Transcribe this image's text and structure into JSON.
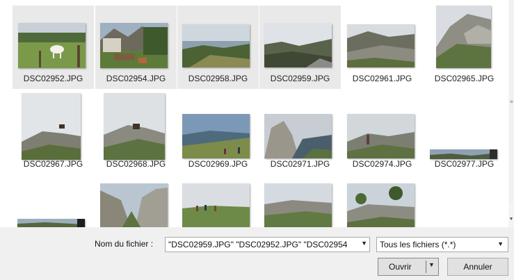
{
  "files": [
    {
      "name": "DSC02952.JPG",
      "selected": true,
      "icon": "photo-cow-pasture-thumbnail"
    },
    {
      "name": "DSC02954.JPG",
      "selected": true,
      "icon": "photo-mountain-hut-thumbnail"
    },
    {
      "name": "DSC02958.JPG",
      "selected": true,
      "icon": "photo-valley-landscape-thumbnail"
    },
    {
      "name": "DSC02959.JPG",
      "selected": true,
      "icon": "photo-cloudy-ridge-thumbnail"
    },
    {
      "name": "DSC02961.JPG",
      "selected": false,
      "icon": "photo-rocky-slope-thumbnail"
    },
    {
      "name": "DSC02965.JPG",
      "selected": false,
      "icon": "photo-cliff-portrait-thumbnail"
    },
    {
      "name": "DSC02967.JPG",
      "selected": false,
      "icon": "photo-ibex-sky-thumbnail"
    },
    {
      "name": "DSC02968.JPG",
      "selected": false,
      "icon": "photo-ibex-rocks-thumbnail"
    },
    {
      "name": "DSC02969.JPG",
      "selected": false,
      "icon": "photo-hikers-valley-thumbnail"
    },
    {
      "name": "DSC02971.JPG",
      "selected": false,
      "icon": "photo-rock-pinnacle-thumbnail"
    },
    {
      "name": "DSC02974.JPG",
      "selected": false,
      "icon": "photo-hiker-ridge-thumbnail"
    },
    {
      "name": "DSC02977.JPG",
      "selected": false,
      "icon": "photo-panorama-thumbnail"
    },
    {
      "name": "",
      "selected": false,
      "icon": "photo-panorama-partial-thumbnail"
    },
    {
      "name": "",
      "selected": false,
      "icon": "photo-cliff-gully-thumbnail"
    },
    {
      "name": "",
      "selected": false,
      "icon": "photo-group-meadow-thumbnail"
    },
    {
      "name": "",
      "selected": false,
      "icon": "photo-ridge-crowd-thumbnail"
    },
    {
      "name": "",
      "selected": false,
      "icon": "photo-trees-rocks-thumbnail"
    }
  ],
  "filename": {
    "label": "Nom du fichier :",
    "value": "\"DSC02959.JPG\" \"DSC02952.JPG\" \"DSC02954",
    "dropdown_icon": "chevron-down-icon"
  },
  "filter": {
    "value": "Tous les fichiers (*.*)",
    "dropdown_icon": "chevron-down-icon"
  },
  "buttons": {
    "open": "Ouvrir",
    "cancel": "Annuler"
  },
  "colors": {
    "selection": "#e9e9e9",
    "panel": "#f0f0f0",
    "button": "#e1e1e1"
  }
}
